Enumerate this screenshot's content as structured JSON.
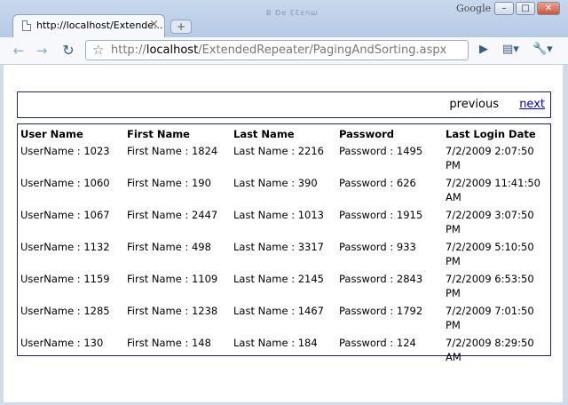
{
  "window": {
    "ghost_title": "Ƀ   Ðe ƐƐєпш",
    "brand": "Google",
    "minimize": "–",
    "maximize": "□",
    "close": "✕"
  },
  "tab": {
    "title": "http://localhost/Extende...",
    "close": "×"
  },
  "newtab": "+",
  "toolbar": {
    "back": "←",
    "forward": "→",
    "reload": "↻",
    "star": "☆",
    "url_scheme": "http://",
    "url_host": "localhost",
    "url_path": "/ExtendedRepeater/PagingAndSorting.aspx",
    "go": "▶",
    "page_menu": "▤▾",
    "tools_menu": "🔧▾"
  },
  "pager": {
    "previous": "previous",
    "next": "next"
  },
  "table": {
    "headers": [
      "User Name",
      "First Name",
      "Last Name",
      "Password",
      "Last Login Date"
    ],
    "rows": [
      [
        "UserName : 1023",
        "First Name : 1824",
        "Last Name : 2216",
        "Password : 1495",
        "7/2/2009 2:07:50 PM"
      ],
      [
        "UserName : 1060",
        "First Name : 190",
        "Last Name : 390",
        "Password : 626",
        "7/2/2009 11:41:50 AM"
      ],
      [
        "UserName : 1067",
        "First Name : 2447",
        "Last Name : 1013",
        "Password : 1915",
        "7/2/2009 3:07:50 PM"
      ],
      [
        "UserName : 1132",
        "First Name : 498",
        "Last Name : 3317",
        "Password : 933",
        "7/2/2009 5:10:50 PM"
      ],
      [
        "UserName : 1159",
        "First Name : 1109",
        "Last Name : 2145",
        "Password : 2843",
        "7/2/2009 6:53:50 PM"
      ],
      [
        "UserName : 1285",
        "First Name : 1238",
        "Last Name : 1467",
        "Password : 1792",
        "7/2/2009 7:01:50 PM"
      ],
      [
        "UserName : 130",
        "First Name : 148",
        "Last Name : 184",
        "Password : 124",
        "7/2/2009 8:29:50 AM"
      ]
    ]
  }
}
